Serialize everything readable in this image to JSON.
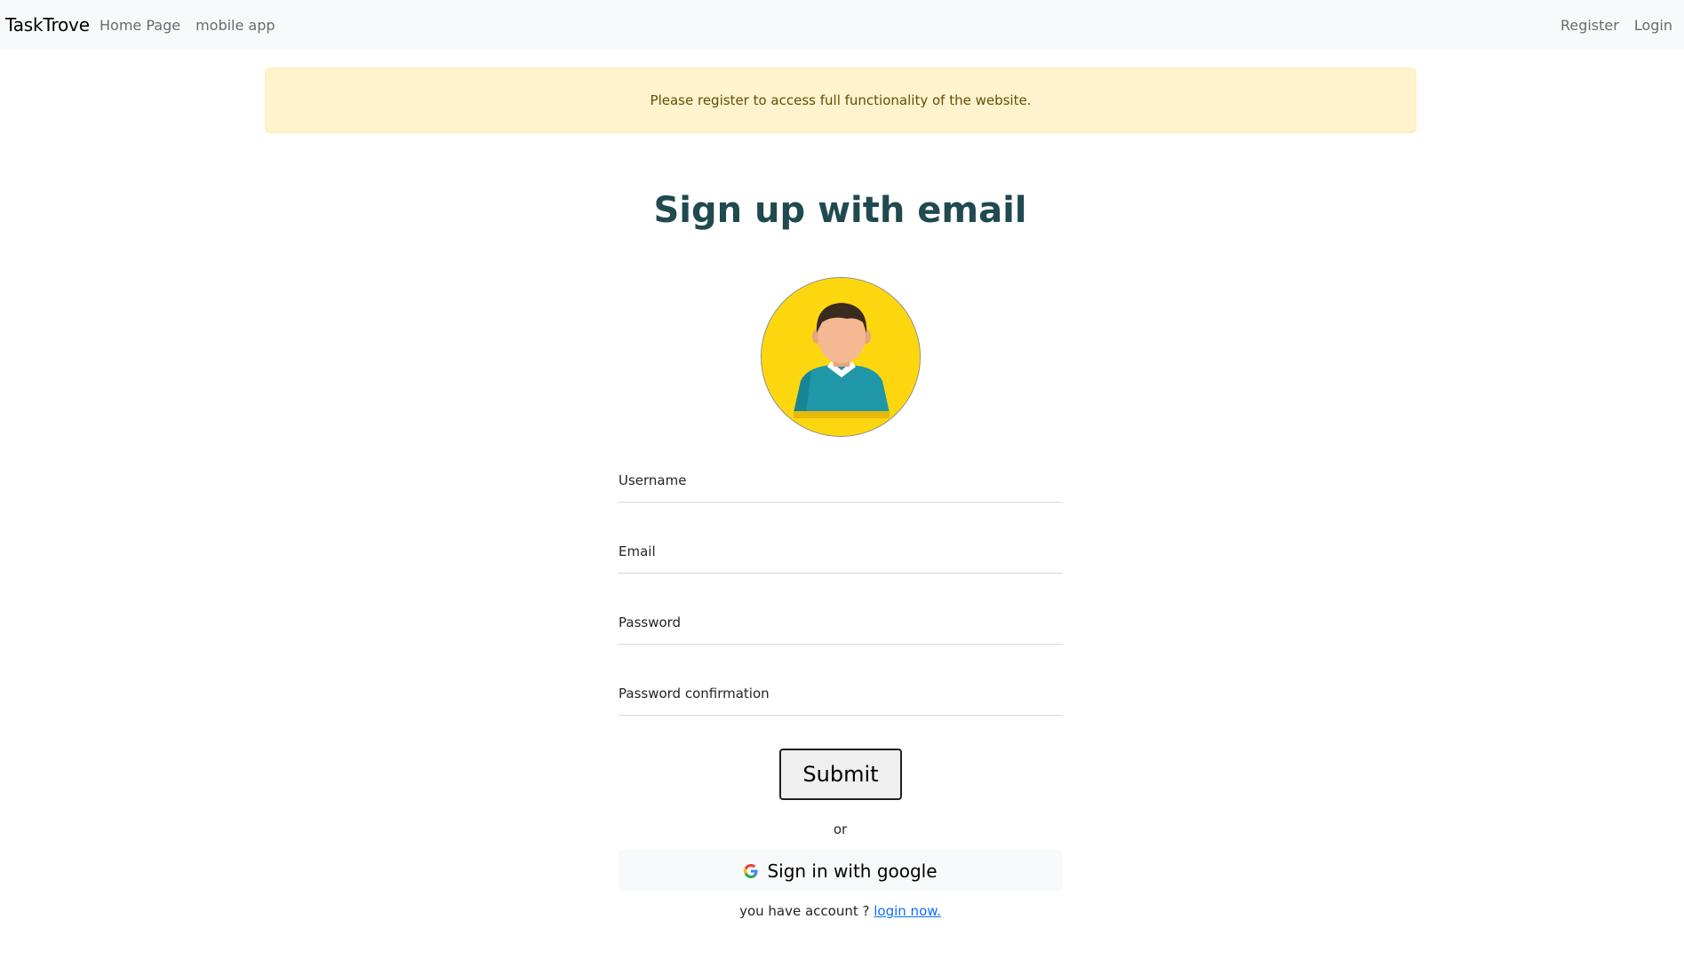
{
  "navbar": {
    "brand": "TaskTrove",
    "left_links": [
      "Home Page",
      "mobile app"
    ],
    "right_links": [
      "Register",
      "Login"
    ]
  },
  "alert": {
    "message": "Please register to access full functionality of the website."
  },
  "main": {
    "title": "Sign up with email"
  },
  "form": {
    "fields": [
      {
        "label": "Username",
        "value": ""
      },
      {
        "label": "Email",
        "value": ""
      },
      {
        "label": "Password",
        "value": ""
      },
      {
        "label": "Password confirmation",
        "value": ""
      }
    ],
    "submit_label": "Submit",
    "or_text": "or",
    "google_label": "Sign in with google",
    "account_prompt": "you have account ?",
    "login_link": "login now."
  },
  "colors": {
    "heading": "#1f4a4f",
    "alert_bg": "#fff3cd",
    "avatar_bg": "#fcd70f",
    "link": "#0d6efd"
  }
}
